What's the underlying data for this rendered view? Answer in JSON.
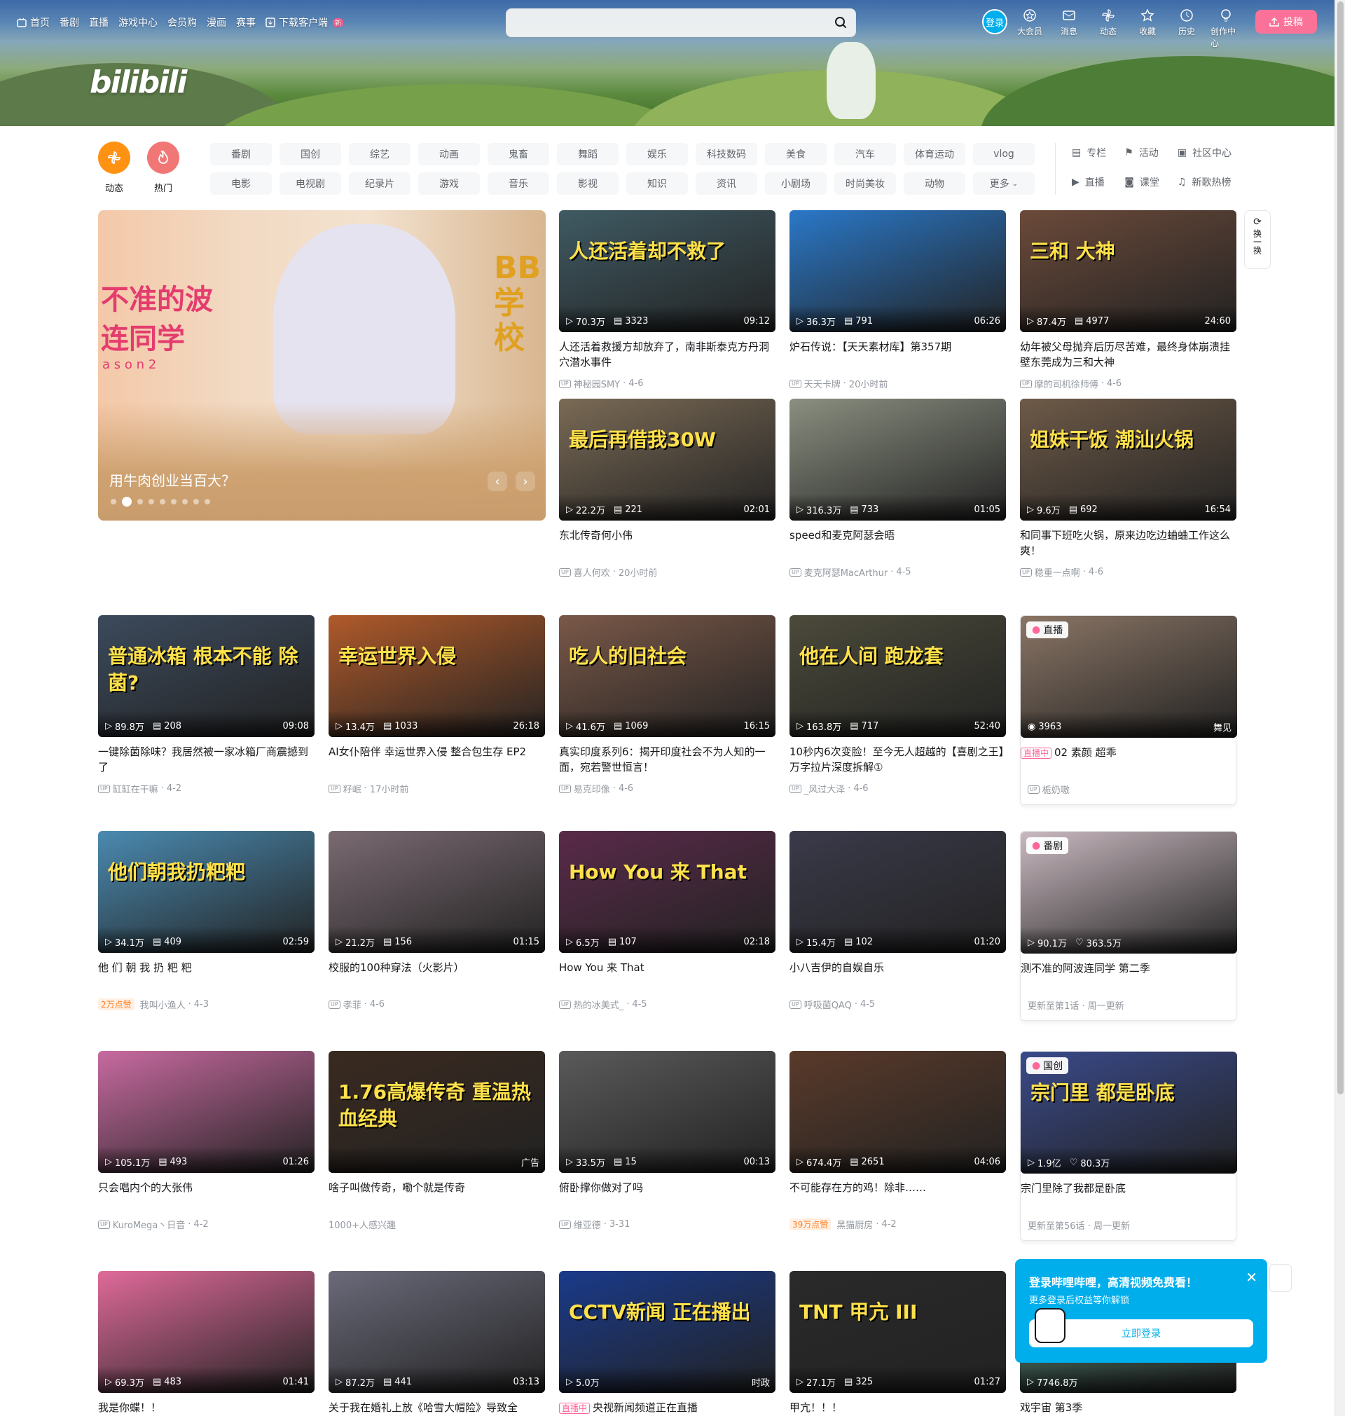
{
  "topnav": {
    "items": [
      "首页",
      "番剧",
      "直播",
      "游戏中心",
      "会员购",
      "漫画",
      "赛事"
    ],
    "download": "下载客户端",
    "download_badge": "新"
  },
  "search": {
    "placeholder": ""
  },
  "header_right": {
    "login": "登录",
    "items": [
      "大会员",
      "消息",
      "动态",
      "收藏",
      "历史",
      "创作中心"
    ],
    "upload": "投稿"
  },
  "logo": "bilibili",
  "channels": {
    "dynamic": "动态",
    "hot": "热门",
    "row1": [
      "番剧",
      "国创",
      "综艺",
      "动画",
      "鬼畜",
      "舞蹈",
      "娱乐",
      "科技数码",
      "美食",
      "汽车",
      "体育运动",
      "vlog"
    ],
    "row2": [
      "电影",
      "电视剧",
      "纪录片",
      "游戏",
      "音乐",
      "影视",
      "知识",
      "资讯",
      "小剧场",
      "时尚美妆",
      "动物",
      "更多"
    ],
    "side": [
      "专栏",
      "活动",
      "社区中心",
      "直播",
      "课堂",
      "新歌热榜"
    ]
  },
  "carousel": {
    "title": "用牛肉创业当百大？",
    "overlay_title": "不准的波连同学",
    "overlay_season": "a s o n 2",
    "overlay_right": "BB 学校"
  },
  "refresh": "换一换",
  "videos": [
    {
      "title": "人还活着救援方却放弃了，南非斯泰克方丹洞穴潜水事件",
      "views": "70.3万",
      "danmaku": "3323",
      "duration": "09:12",
      "author": "神秘园SMY",
      "date": "4-6",
      "overlay": "人还活着却不救了",
      "color": "#3f5a63"
    },
    {
      "title": "炉石传说：【天天素材库】第357期",
      "views": "36.3万",
      "danmaku": "791",
      "duration": "06:26",
      "author": "天天卡牌",
      "date": "20小时前",
      "color": "#2a78c8"
    },
    {
      "title": "幼年被父母抛弃后历尽苦难，最终身体崩溃挂壁东莞成为三和大神",
      "views": "87.4万",
      "danmaku": "4977",
      "duration": "24:60",
      "author": "摩的司机徐师傅",
      "date": "4-6",
      "overlay": "三和  大神",
      "color": "#6b4a3a"
    },
    {
      "title": "东北传奇何小伟",
      "views": "22.2万",
      "danmaku": "221",
      "duration": "02:01",
      "author": "喜人何欢",
      "date": "20小时前",
      "overlay": "最后再借我30W",
      "color": "#7a6a55"
    },
    {
      "title": "speed和麦克阿瑟会晤",
      "views": "316.3万",
      "danmaku": "733",
      "duration": "01:05",
      "author": "麦克阿瑟MacArthur",
      "date": "4-5",
      "color": "#8a8f80"
    },
    {
      "title": "和同事下班吃火锅，原来边吃边蛐蛐工作这么爽！",
      "views": "9.6万",
      "danmaku": "692",
      "duration": "16:54",
      "author": "稳重一点啊",
      "date": "4-6",
      "overlay": "姐妹干饭  潮汕火锅",
      "color": "#6e5a48"
    },
    {
      "title": "一键除菌除味？我居然被一家冰箱厂商震撼到了",
      "views": "89.8万",
      "danmaku": "208",
      "duration": "09:08",
      "author": "缸缸在干嘛",
      "date": "4-2",
      "overlay": "普通冰箱 根本不能 除菌?",
      "color": "#3c4a5c"
    },
    {
      "title": "AI女仆陪伴 幸运世界入侵 整合包生存 EP2",
      "views": "13.4万",
      "danmaku": "1033",
      "duration": "26:18",
      "author": "籽岷",
      "date": "17小时前",
      "overlay": "幸运世界入侵",
      "color": "#b05a2a"
    },
    {
      "title": "真实印度系列6：揭开印度社会不为人知的一面，宛若警世恒言！",
      "views": "41.6万",
      "danmaku": "1069",
      "duration": "16:15",
      "author": "易克印像",
      "date": "4-6",
      "overlay": "吃人的旧社会",
      "color": "#7a5848"
    },
    {
      "title": "10秒内6次变脸！至今无人超越的【喜剧之王】万字拉片深度拆解①",
      "views": "163.8万",
      "danmaku": "717",
      "duration": "52:40",
      "author": "_风过大泽",
      "date": "4-6",
      "overlay": "他在人间 跑龙套",
      "color": "#4b4a3a"
    },
    {
      "live": true,
      "ribbon": "直播",
      "title": "02 素颜 超乖",
      "watchers": "3963",
      "category": "舞见",
      "author": "栀奶嗷",
      "live_tag": "直播中",
      "color": "#8a7565"
    },
    {
      "title": "他 们 朝 我 扔 粑 粑",
      "views": "34.1万",
      "danmaku": "409",
      "duration": "02:59",
      "author": "我叫小渔人",
      "date": "4-3",
      "tag": "2万点赞",
      "overlay": "他们朝我扔粑粑",
      "color": "#4a8ab0"
    },
    {
      "title": "校服的100种穿法（火影片）",
      "views": "21.2万",
      "danmaku": "156",
      "duration": "01:15",
      "author": "孝菲",
      "date": "4-6",
      "color": "#7a6a72"
    },
    {
      "title": "How You 来 That",
      "views": "6.5万",
      "danmaku": "107",
      "duration": "02:18",
      "author": "热的冰美式_",
      "date": "4-5",
      "overlay": "How You 来 That",
      "color": "#5a2a4a"
    },
    {
      "title": "小八吉伊的自娱自乐",
      "views": "15.4万",
      "danmaku": "102",
      "duration": "01:20",
      "author": "呼吸菌QAQ",
      "date": "4-5",
      "color": "#3a3a4a"
    },
    {
      "bangumi": true,
      "ribbon": "番剧",
      "title": "测不准的阿波连同学 第二季",
      "views": "90.1万",
      "likes": "363.5万",
      "update": "更新至第1话 · 周一更新",
      "color": "#c9b9c0"
    },
    {
      "title": "只会唱内个的大张伟",
      "views": "105.1万",
      "danmaku": "493",
      "duration": "01:26",
      "author": "KuroMega丶日音",
      "date": "4-2",
      "color": "#c86aa0"
    },
    {
      "ad": true,
      "title": "啥子叫做传奇，嘞个就是传奇",
      "views": "",
      "danmaku": "",
      "duration": "广告",
      "author": "1000+人感兴趣",
      "overlay": "1.76高爆传奇  重温热血经典",
      "color": "#3a2a20"
    },
    {
      "title": "俯卧撑你做对了吗",
      "views": "33.5万",
      "danmaku": "15",
      "duration": "00:13",
      "author": "维亚德",
      "date": "3-31",
      "color": "#5a5a5a"
    },
    {
      "title": "不可能存在方的鸡！除非……",
      "views": "674.4万",
      "danmaku": "2651",
      "duration": "04:06",
      "author": "黑猫厨房",
      "date": "4-2",
      "tag": "39万点赞",
      "color": "#5a3a2a"
    },
    {
      "bangumi": true,
      "ribbon": "国创",
      "title": "宗门里除了我都是卧底",
      "views": "1.9亿",
      "likes": "80.3万",
      "update": "更新至第56话 · 周一更新",
      "overlay": "宗门里 都是卧底",
      "color": "#3a4a8a"
    },
    {
      "title": "我是你蝶！！",
      "views": "69.3万",
      "danmaku": "483",
      "duration": "01:41",
      "color": "#e06a9a"
    },
    {
      "title": "关于我在婚礼上放《哈雪大帽险》导致全",
      "views": "87.2万",
      "danmaku": "441",
      "duration": "03:13",
      "color": "#6a6a7a"
    },
    {
      "title": "央视新闻频道正在直播",
      "live_tag": "直播中",
      "views": "5.0万",
      "duration": "时政",
      "overlay": "CCTV新闻 正在播出",
      "color": "#1a3a8a"
    },
    {
      "title": "甲亢！！！",
      "views": "27.1万",
      "danmaku": "325",
      "duration": "01:27",
      "overlay": "TNT 甲亢 III",
      "color": "#2a2a2a"
    },
    {
      "title": "戏宇宙 第3季",
      "views": "7746.8万",
      "color": "#4a7a6a"
    }
  ],
  "popup": {
    "title": "登录哔哩哔哩，高清视频免费看！",
    "subtitle": "更多登录后权益等你解锁",
    "button": "立即登录"
  }
}
